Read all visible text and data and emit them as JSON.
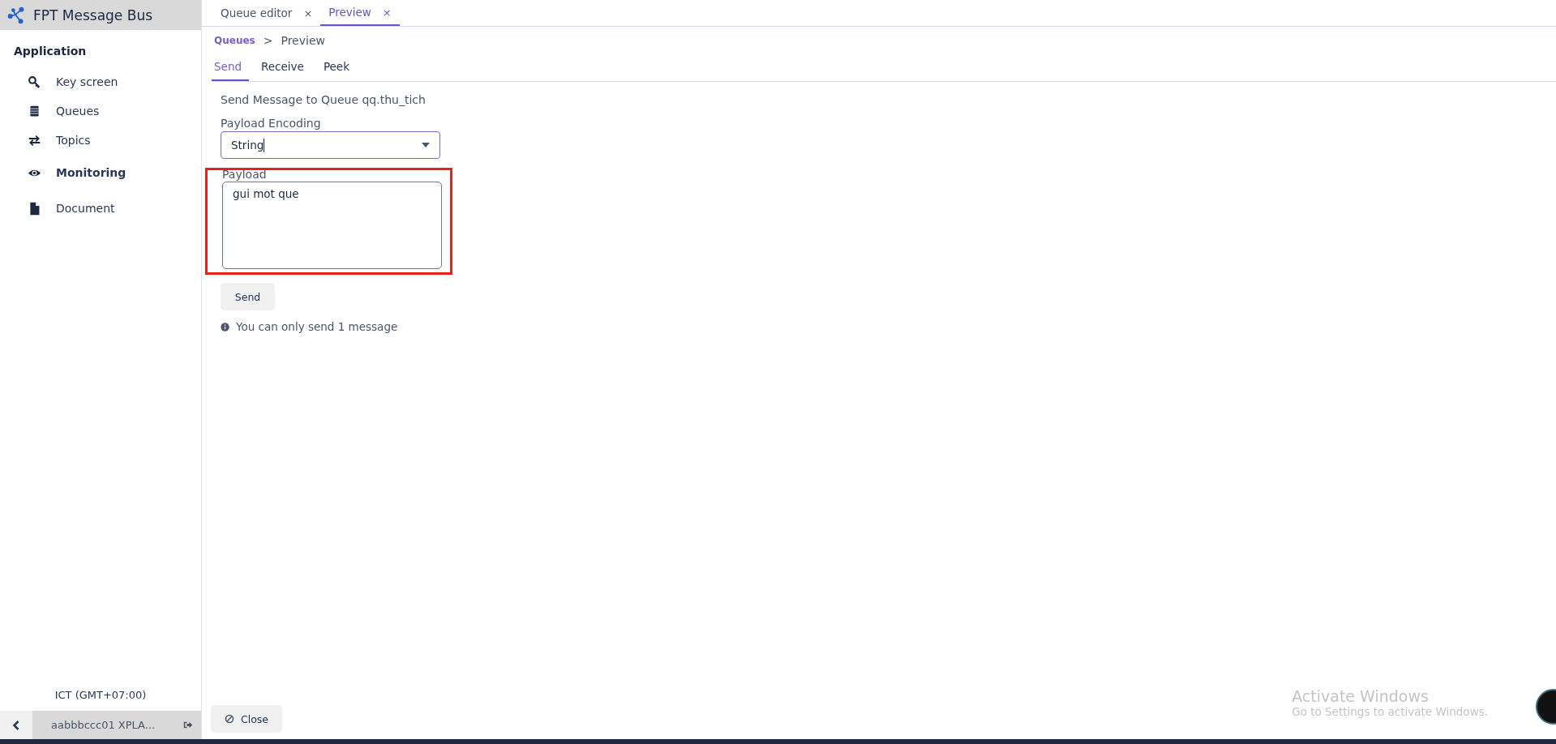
{
  "app": {
    "title": "FPT Message Bus"
  },
  "sidebar": {
    "section": "Application",
    "items": [
      {
        "label": "Key screen",
        "bold": false
      },
      {
        "label": "Queues",
        "bold": false
      },
      {
        "label": "Topics",
        "bold": false
      },
      {
        "label": "Monitoring",
        "bold": true
      },
      {
        "label": "Document",
        "bold": false
      }
    ],
    "timezone": "ICT (GMT+07:00)",
    "user": "aabbbccc01 XPLA..."
  },
  "editor_tabs": [
    {
      "label": "Queue editor",
      "close": "×",
      "selected": false
    },
    {
      "label": "Preview",
      "close": "×",
      "selected": true
    }
  ],
  "breadcrumb": {
    "link": "Queues",
    "separator": ">",
    "current": "Preview"
  },
  "sub_tabs": [
    {
      "label": "Send",
      "selected": true
    },
    {
      "label": "Receive",
      "selected": false
    },
    {
      "label": "Peek",
      "selected": false
    }
  ],
  "form": {
    "heading": "Send Message to Queue qq.thu_tich",
    "encoding_label": "Payload Encoding",
    "encoding_value": "String",
    "payload_label": "Payload",
    "payload_value": "gui mot que",
    "payload_highlighted": true,
    "send_button": "Send",
    "note": "You can only send 1 message"
  },
  "close_button": "Close",
  "os_notice": {
    "title": "Activate Windows",
    "text": "Go to Settings to activate Windows."
  }
}
